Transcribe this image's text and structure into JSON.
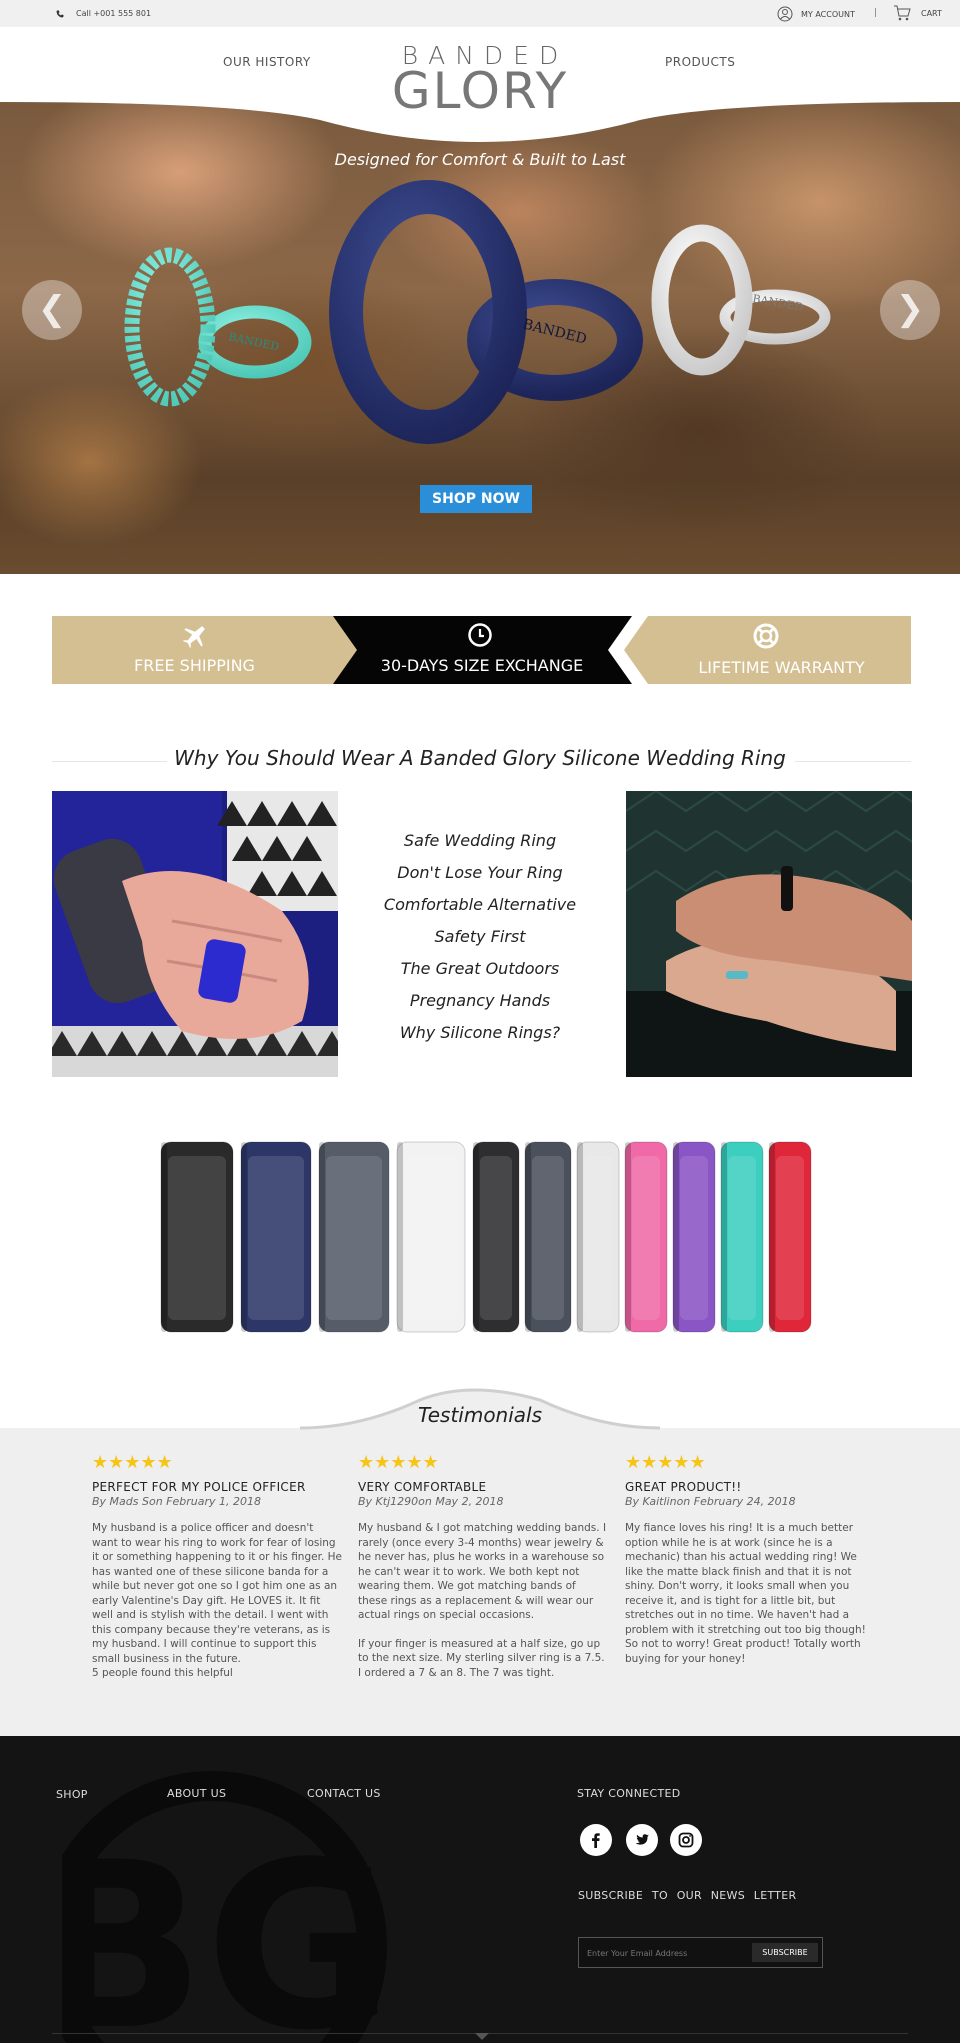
{
  "topbar": {
    "phone": "Call +001 555 801",
    "account": "MY ACCOUNT",
    "separator": "|",
    "cart": "CART"
  },
  "header": {
    "nav_left": "OUR HISTORY",
    "nav_right": "PRODUCTS",
    "logo_line1": "BANDED",
    "logo_line2": "GLORY"
  },
  "hero": {
    "tagline": "Designed for Comfort & Built to Last",
    "ring_engraving": "BANDED",
    "cta": "SHOP NOW",
    "prev_arrow": "❮",
    "next_arrow": "❯"
  },
  "banners": [
    {
      "label": "FREE SHIPPING",
      "icon": "airplane-icon"
    },
    {
      "label": "30-DAYS SIZE EXCHANGE",
      "icon": "clock-icon"
    },
    {
      "label": "LIFETIME WARRANTY",
      "icon": "lifebuoy-icon"
    }
  ],
  "why": {
    "title": "Why You Should Wear A Banded Glory Silicone Wedding Ring",
    "reasons": [
      "Safe Wedding Ring",
      "Don't Lose Your Ring",
      "Comfortable Alternative",
      "Safety First",
      "The Great Outdoors",
      "Pregnancy Hands",
      "Why Silicone Rings?"
    ]
  },
  "lineup": {
    "colors": [
      "#2a2a2a",
      "#2c3768",
      "#565d69",
      "#f2f2f2",
      "#2e2e30",
      "#4a505c",
      "#e8e8e8",
      "#f06aa8",
      "#8a55c4",
      "#3ccfc0",
      "#e0273a"
    ]
  },
  "testimonials": {
    "title": "Testimonials",
    "reviews": [
      {
        "stars": "★★★★★",
        "title": "PERFECT FOR MY POLICE OFFICER",
        "by": "By Mads Son February 1, 2018",
        "paragraphs": [
          "My husband is a police officer and doesn't want to wear his ring to work for fear of losing it or something happening to it or his finger. He has wanted one of these silicone banda for a while but never got one so I got him one as an early Valentine's Day gift. He LOVES it. It fit well and is stylish with the detail. I went with this company because they're veterans, as is my husband. I will continue to support this small business in the future.",
          "5 people found this helpful"
        ]
      },
      {
        "stars": "★★★★★",
        "title": "VERY COMFORTABLE",
        "by": "By Ktj1290on May 2, 2018",
        "paragraphs": [
          "My husband & I got matching wedding bands. I rarely (once every 3-4 months) wear jewelry & he never has, plus he works in a warehouse so he can't wear it to work. We both kept not wearing them. We got matching bands of these rings as a replacement & will wear our actual rings on special occasions.",
          "If your finger is measured at a half size, go up to the next size. My sterling silver ring is a 7.5. I ordered a 7 & an 8. The 7 was tight."
        ]
      },
      {
        "stars": "★★★★★",
        "title": "GREAT PRODUCT!!",
        "by": "By Kaitlinon February 24, 2018",
        "paragraphs": [
          "My fiance loves his ring! It is a much better option while he is at work (since he is a mechanic) than his actual wedding ring! We like the matte black finish and that it is not shiny. Don't worry, it looks small when you receive it, and is tight for a little bit, but stretches out in no time. We haven't had a problem with it stretching out too big though! So not to worry! Great product! Totally worth buying for your honey!"
        ]
      }
    ]
  },
  "footer": {
    "nav": [
      "SHOP",
      "ABOUT US",
      "CONTACT US"
    ],
    "stay_connected": "STAY CONNECTED",
    "subscribe_label": "SUBSCRIBE TO OUR NEWS LETTER",
    "email_placeholder": "Enter Your Email Address",
    "subscribe_button": "SUBSCRIBE",
    "watermark": "BG"
  }
}
